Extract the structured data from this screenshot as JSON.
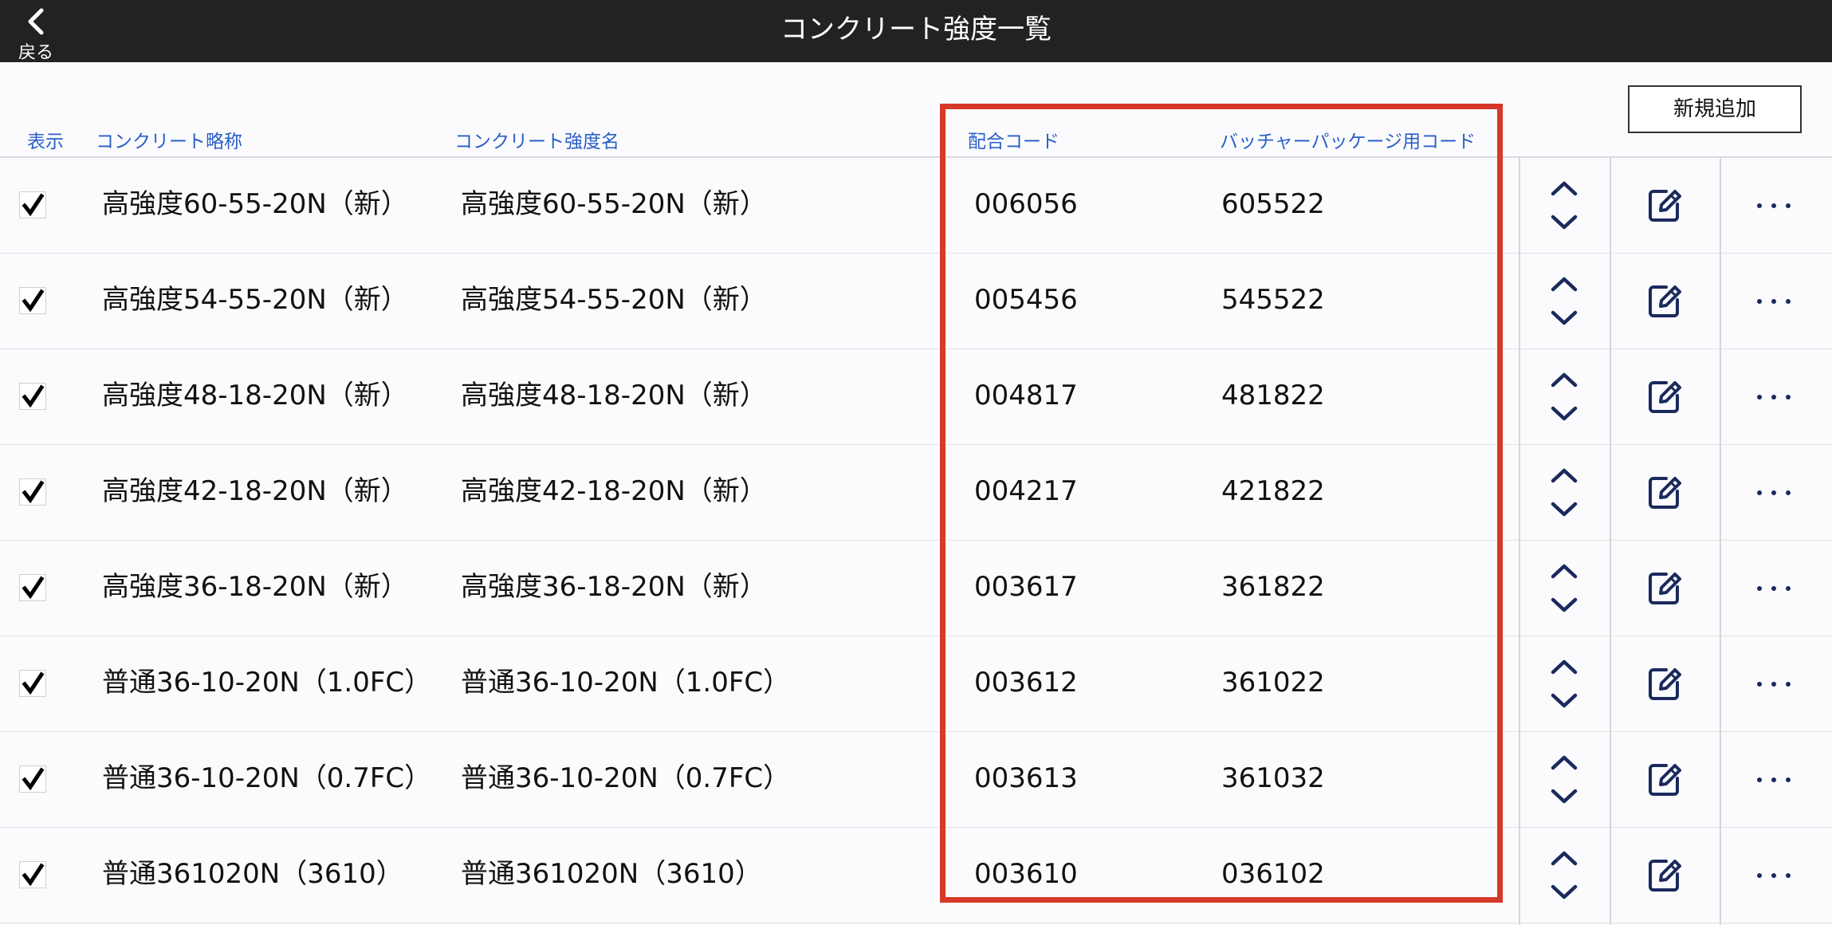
{
  "header": {
    "back_label": "戻る",
    "title": "コンクリート強度一覧"
  },
  "toolbar": {
    "add_label": "新規追加"
  },
  "columns": {
    "display": "表示",
    "abbrev": "コンクリート略称",
    "name": "コンクリート強度名",
    "mix_code": "配合コード",
    "batcher_code": "バッチャーパッケージ用コード"
  },
  "rows": [
    {
      "checked": true,
      "abbrev": "高強度60-55-20N（新）",
      "name": "高強度60-55-20N（新）",
      "mix_code": "006056",
      "batcher_code": "605522"
    },
    {
      "checked": true,
      "abbrev": "高強度54-55-20N（新）",
      "name": "高強度54-55-20N（新）",
      "mix_code": "005456",
      "batcher_code": "545522"
    },
    {
      "checked": true,
      "abbrev": "高強度48-18-20N（新）",
      "name": "高強度48-18-20N（新）",
      "mix_code": "004817",
      "batcher_code": "481822"
    },
    {
      "checked": true,
      "abbrev": "高強度42-18-20N（新）",
      "name": "高強度42-18-20N（新）",
      "mix_code": "004217",
      "batcher_code": "421822"
    },
    {
      "checked": true,
      "abbrev": "高強度36-18-20N（新）",
      "name": "高強度36-18-20N（新）",
      "mix_code": "003617",
      "batcher_code": "361822"
    },
    {
      "checked": true,
      "abbrev": "普通36-10-20N（1.0FC）",
      "name": "普通36-10-20N（1.0FC）",
      "mix_code": "003612",
      "batcher_code": "361022"
    },
    {
      "checked": true,
      "abbrev": "普通36-10-20N（0.7FC）",
      "name": "普通36-10-20N（0.7FC）",
      "mix_code": "003613",
      "batcher_code": "361032"
    },
    {
      "checked": true,
      "abbrev": "普通361020N（3610）",
      "name": "普通361020N（3610）",
      "mix_code": "003610",
      "batcher_code": "036102"
    }
  ],
  "icons": {
    "back": "chevron-left-icon",
    "check": "checkmark-icon",
    "reorder": "reorder-arrows-icon",
    "edit": "edit-icon",
    "more": "more-dots-icon"
  },
  "colors": {
    "topbar": "#222222",
    "header_text": "#2a5fc8",
    "icon_navy": "#1a2a5c",
    "highlight": "#d6382a"
  }
}
